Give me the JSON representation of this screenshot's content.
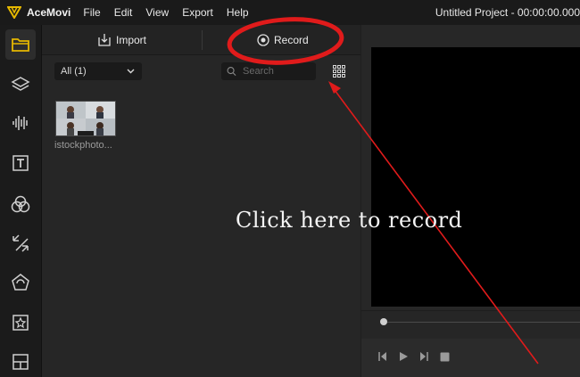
{
  "app": {
    "name": "AceMovi",
    "project_title": "Untitled Project - 00:00:00.000"
  },
  "menu": [
    {
      "label": "File"
    },
    {
      "label": "Edit"
    },
    {
      "label": "View"
    },
    {
      "label": "Export"
    },
    {
      "label": "Help"
    }
  ],
  "sidebar": {
    "items": [
      {
        "icon": "folder-icon",
        "active": true
      },
      {
        "icon": "layers-icon",
        "active": false
      },
      {
        "icon": "audio-waveform-icon",
        "active": false
      },
      {
        "icon": "text-icon",
        "active": false
      },
      {
        "icon": "filters-icon",
        "active": false
      },
      {
        "icon": "transitions-icon",
        "active": false
      },
      {
        "icon": "effects-icon",
        "active": false
      },
      {
        "icon": "elements-icon",
        "active": false
      },
      {
        "icon": "split-screen-icon",
        "active": false
      }
    ]
  },
  "media_panel": {
    "import_label": "Import",
    "record_label": "Record",
    "filter_value": "All (1)",
    "search_placeholder": "Search",
    "media_items": [
      {
        "label": "istockphoto..."
      }
    ]
  },
  "annotation": {
    "text": "Click here to record",
    "color": "#e01b1b"
  },
  "colors": {
    "accent": "#e6b800",
    "annotation_red": "#e01b1b"
  }
}
